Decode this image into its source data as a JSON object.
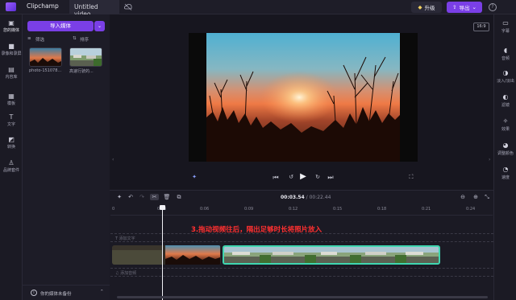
{
  "header": {
    "app_name": "Clipchamp",
    "doc_tab": "Untitled video",
    "upgrade_label": "升级",
    "export_label": "导出",
    "help": "?"
  },
  "left_rail": {
    "items": [
      {
        "label": "您的媒体",
        "icon": "media-icon"
      },
      {
        "label": "录像和录屏",
        "icon": "camera-icon"
      },
      {
        "label": "内容库",
        "icon": "library-icon"
      },
      {
        "label": "模板",
        "icon": "template-icon"
      },
      {
        "label": "文字",
        "icon": "text-icon"
      },
      {
        "label": "转换",
        "icon": "transition-icon"
      },
      {
        "label": "品牌套件",
        "icon": "brand-icon"
      }
    ]
  },
  "media_panel": {
    "import_label": "导入媒体",
    "filter_label": "筛选",
    "sort_label": "排序",
    "thumbs": [
      {
        "caption": "photo-151078..."
      },
      {
        "caption": "高速行驶的..."
      }
    ],
    "backup_text": "你的媒体未备份"
  },
  "preview": {
    "aspect_label": "16:9"
  },
  "right_rail": {
    "items": [
      {
        "label": "字幕",
        "icon": "captions-icon"
      },
      {
        "label": "音频",
        "icon": "audio-icon"
      },
      {
        "label": "淡入/淡出",
        "icon": "fade-icon"
      },
      {
        "label": "滤镜",
        "icon": "filter-icon"
      },
      {
        "label": "效果",
        "icon": "effects-icon"
      },
      {
        "label": "调整颜色",
        "icon": "color-icon"
      },
      {
        "label": "速度",
        "icon": "speed-icon"
      }
    ]
  },
  "timeline": {
    "current_time": "00:03.54",
    "total_time": "/ 00:22.44",
    "ticks": [
      "0",
      "0:03",
      "0:06",
      "0:09",
      "0:12",
      "0:15",
      "0:18",
      "0:21",
      "0:24"
    ],
    "text_track_label": "T  添加文字",
    "audio_track_label": "♫  添加音频",
    "annotation": "3.拖动视频往后，隔出足够时长将照片放入"
  },
  "colors": {
    "accent": "#7a3fe6",
    "selection": "#3fd6b0",
    "annotation": "#ff3030"
  }
}
